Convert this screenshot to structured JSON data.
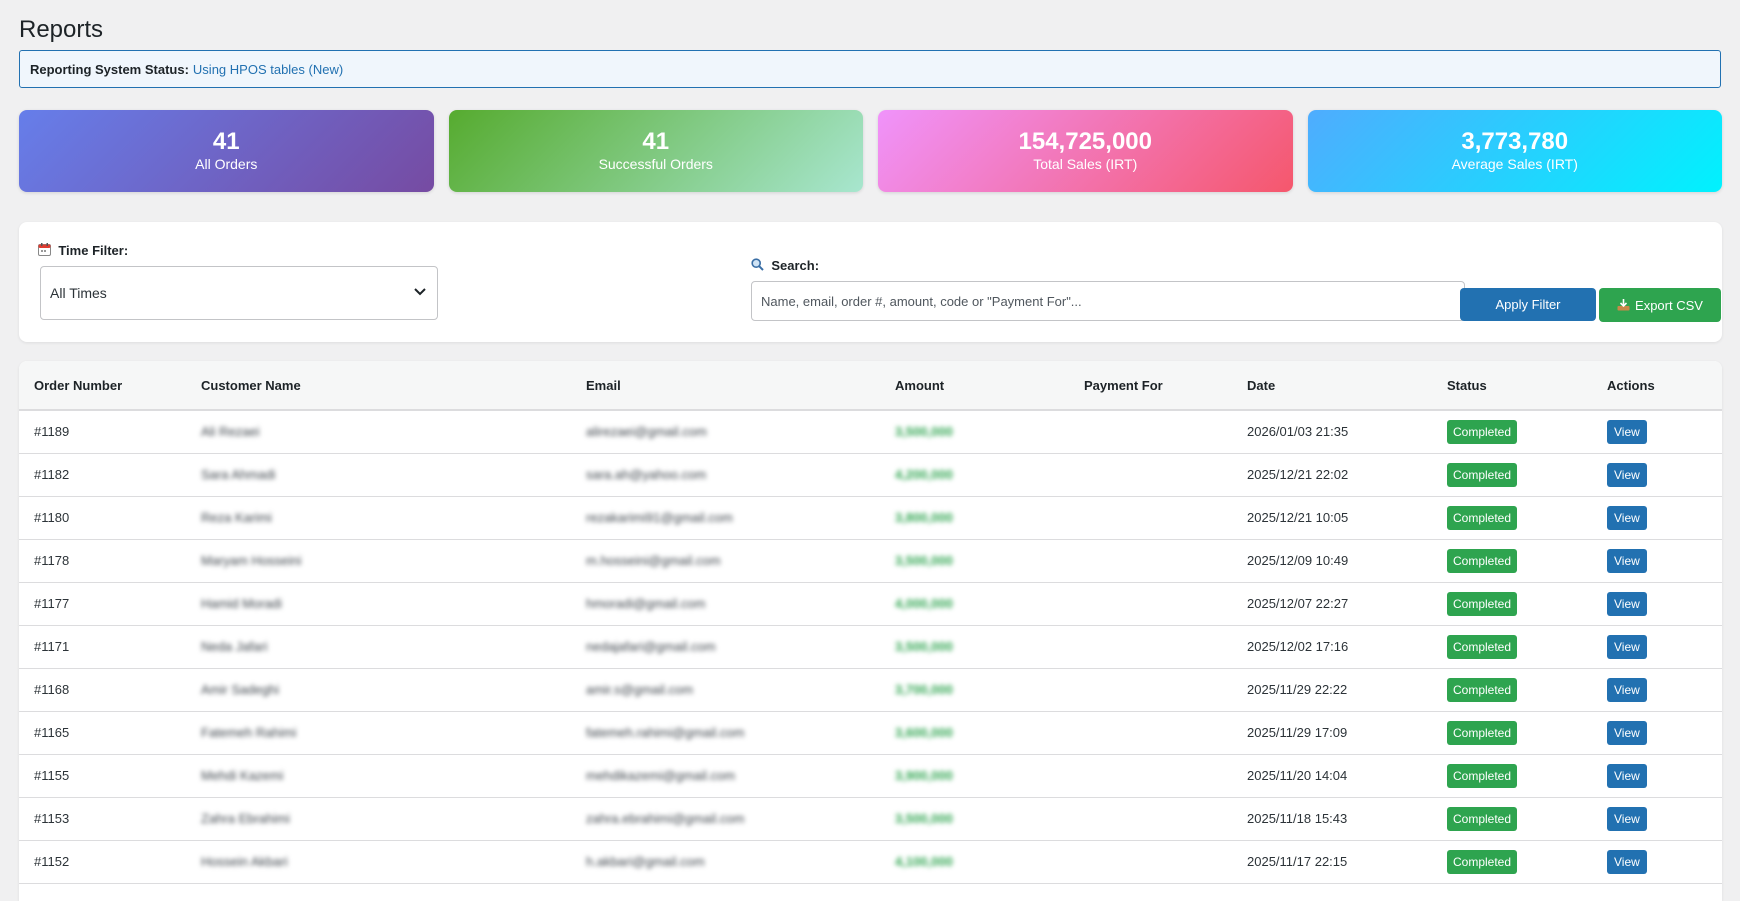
{
  "page_title": "Reports",
  "status": {
    "label": "Reporting System Status:",
    "value": "Using HPOS tables (New)"
  },
  "stats": [
    {
      "value": "41",
      "caption": "All Orders"
    },
    {
      "value": "41",
      "caption": "Successful Orders"
    },
    {
      "value": "154,725,000",
      "caption": "Total Sales (IRT)"
    },
    {
      "value": "3,773,780",
      "caption": "Average Sales (IRT)"
    }
  ],
  "filters": {
    "time_label": "Time Filter:",
    "time_icon": "calendar-icon",
    "time_value": "All Times",
    "search_label": "Search:",
    "search_icon": "magnifier-icon",
    "search_placeholder": "Name, email, order #, amount, code or \"Payment For\"...",
    "apply_label": "Apply Filter",
    "export_label": "Export CSV",
    "export_icon": "download-tray-icon"
  },
  "table": {
    "headers": {
      "order_number": "Order Number",
      "customer_name": "Customer Name",
      "email": "Email",
      "amount": "Amount",
      "payment_for": "Payment For",
      "date": "Date",
      "status": "Status",
      "actions": "Actions"
    },
    "rows": [
      {
        "order": "#1189",
        "name": "Ali Rezaei",
        "email": "alirezaei@gmail.com",
        "amount": "3,500,000",
        "payment_for": "",
        "date": "2026/01/03 21:35",
        "status": "Completed",
        "action": "View"
      },
      {
        "order": "#1182",
        "name": "Sara Ahmadi",
        "email": "sara.ah@yahoo.com",
        "amount": "4,200,000",
        "payment_for": "",
        "date": "2025/12/21 22:02",
        "status": "Completed",
        "action": "View"
      },
      {
        "order": "#1180",
        "name": "Reza Karimi",
        "email": "rezakarimi91@gmail.com",
        "amount": "3,800,000",
        "payment_for": "",
        "date": "2025/12/21 10:05",
        "status": "Completed",
        "action": "View"
      },
      {
        "order": "#1178",
        "name": "Maryam Hosseini",
        "email": "m.hosseini@gmail.com",
        "amount": "3,500,000",
        "payment_for": "",
        "date": "2025/12/09 10:49",
        "status": "Completed",
        "action": "View"
      },
      {
        "order": "#1177",
        "name": "Hamid Moradi",
        "email": "hmoradi@gmail.com",
        "amount": "4,000,000",
        "payment_for": "",
        "date": "2025/12/07 22:27",
        "status": "Completed",
        "action": "View"
      },
      {
        "order": "#1171",
        "name": "Neda Jafari",
        "email": "nedajafari@gmail.com",
        "amount": "3,500,000",
        "payment_for": "",
        "date": "2025/12/02 17:16",
        "status": "Completed",
        "action": "View"
      },
      {
        "order": "#1168",
        "name": "Amir Sadeghi",
        "email": "amir.s@gmail.com",
        "amount": "3,700,000",
        "payment_for": "",
        "date": "2025/11/29 22:22",
        "status": "Completed",
        "action": "View"
      },
      {
        "order": "#1165",
        "name": "Fatemeh Rahimi",
        "email": "fatemeh.rahimi@gmail.com",
        "amount": "3,600,000",
        "payment_for": "",
        "date": "2025/11/29 17:09",
        "status": "Completed",
        "action": "View"
      },
      {
        "order": "#1155",
        "name": "Mehdi Kazemi",
        "email": "mehdikazemi@gmail.com",
        "amount": "3,900,000",
        "payment_for": "",
        "date": "2025/11/20 14:04",
        "status": "Completed",
        "action": "View"
      },
      {
        "order": "#1153",
        "name": "Zahra Ebrahimi",
        "email": "zahra.ebrahimi@gmail.com",
        "amount": "3,500,000",
        "payment_for": "",
        "date": "2025/11/18 15:43",
        "status": "Completed",
        "action": "View"
      },
      {
        "order": "#1152",
        "name": "Hossein Akbari",
        "email": "h.akbari@gmail.com",
        "amount": "4,100,000",
        "payment_for": "",
        "date": "2025/11/17 22:15",
        "status": "Completed",
        "action": "View"
      }
    ]
  },
  "colors": {
    "primary": "#2271b1",
    "success": "#2ea44f",
    "card1": "#667eea",
    "card2": "#56ab2f",
    "card3": "#f5576c",
    "card4": "#4facfe"
  }
}
